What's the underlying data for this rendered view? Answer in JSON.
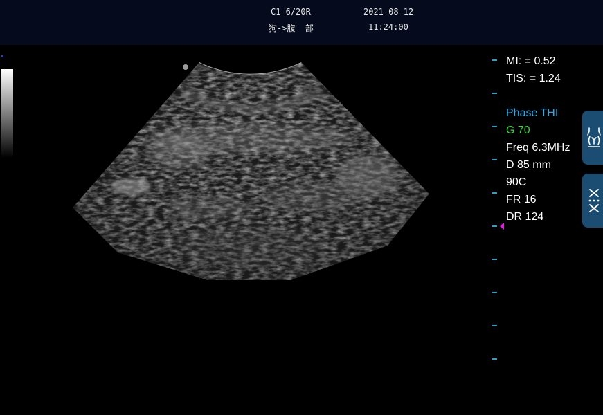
{
  "header": {
    "probe": "C1-6/20R",
    "mode": "狗->腹  部",
    "date": "2021-08-12",
    "time": "11:24:00"
  },
  "params": {
    "mi": "MI: = 0.52",
    "tis": "TIS: = 1.24",
    "phase": "Phase THI",
    "gain": "G 70",
    "freq": "Freq 6.3MHz",
    "depth": "D 85 mm",
    "angle": "90C",
    "fr": "FR 16",
    "dr": "DR 124"
  },
  "colors": {
    "header_bg": "#050b1c",
    "phase_text": "#2aa8e6",
    "gain_text": "#33d633",
    "tick": "#2aa3c0",
    "focus_marker": "#e020e0",
    "side_button": "#1b4c72"
  },
  "side_buttons": [
    {
      "icon": "body-marker-icon"
    },
    {
      "icon": "collapse-icon"
    }
  ]
}
